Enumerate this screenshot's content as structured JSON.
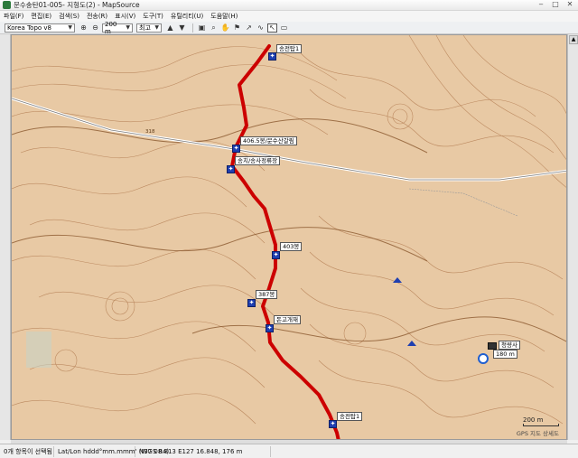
{
  "window": {
    "title": "문수송탄01-005- 지형도(2) - MapSource"
  },
  "menu": [
    "파일(F)",
    "편집(E)",
    "검색(S)",
    "전송(R)",
    "표시(V)",
    "도구(T)",
    "유틸리티(U)",
    "도움말(H)"
  ],
  "toolbar": {
    "map_product": "Korea Topo v8",
    "zoom": "200 m",
    "detail": "최고"
  },
  "map": {
    "road_number": "318",
    "waypoints": [
      {
        "label": "송전탑1"
      },
      {
        "label": "406.5봉/문수산갈림"
      },
      {
        "label": "송치/송사정류장"
      },
      {
        "label": "403봉"
      },
      {
        "label": "387봉"
      },
      {
        "label": "돈고개재"
      },
      {
        "label": "송전탑1"
      }
    ],
    "place_labels": [
      "청량사",
      "180 m",
      "송전탑"
    ],
    "scale": "200 m",
    "gps_label": "GPS 지도 상세도"
  },
  "status": {
    "selection": "0개 항목이 선택됨",
    "format": "Lat/Lon hddd°mm.mmm' (WGS 84)",
    "coords": "N37 08.813 E127 16.848, 176 m"
  },
  "colors": {
    "terrain": "#e8c9a4",
    "route": "#cc0000",
    "waypoint": "#1f3fb0"
  }
}
